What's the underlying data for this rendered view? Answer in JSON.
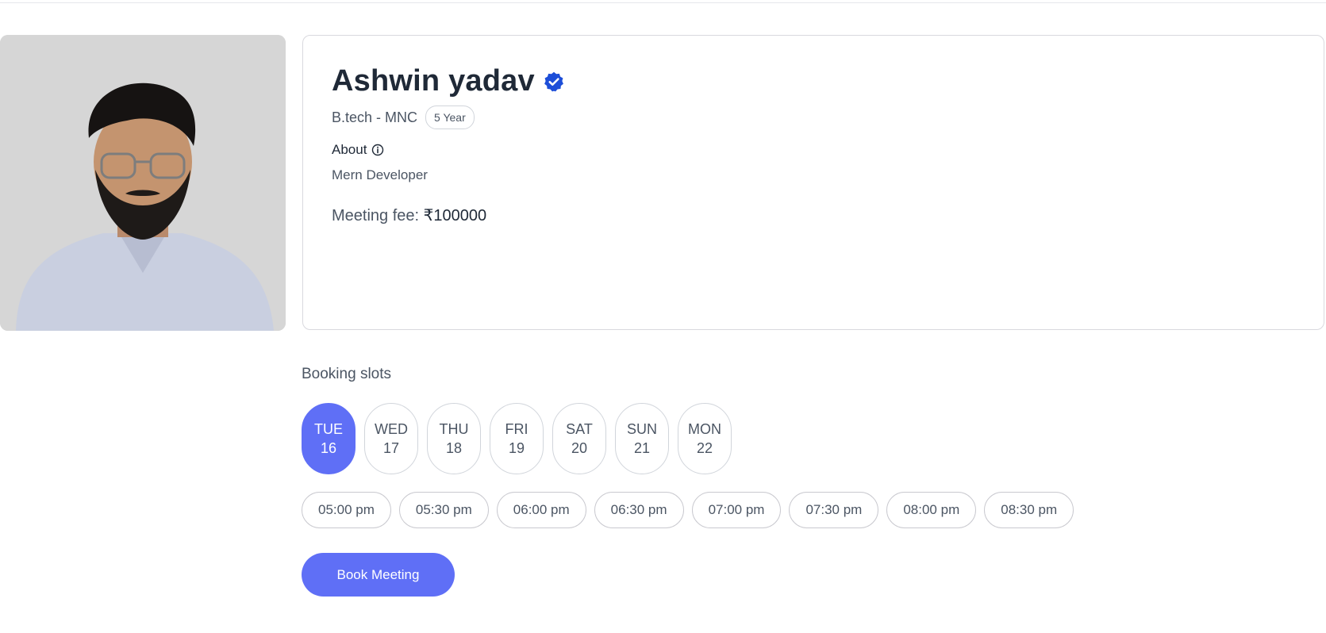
{
  "doctor": {
    "name": "Ashwin yadav",
    "degree": "B.tech - MNC",
    "experience": "5 Year",
    "about_label": "About",
    "about_text": "Mern Developer",
    "fee_label": "Meeting fee:",
    "fee_value": "₹100000",
    "photo_alt": "Ashwin yadav"
  },
  "booking": {
    "title": "Booking slots",
    "days": [
      {
        "day": "TUE",
        "date": "16",
        "selected": true
      },
      {
        "day": "WED",
        "date": "17",
        "selected": false
      },
      {
        "day": "THU",
        "date": "18",
        "selected": false
      },
      {
        "day": "FRI",
        "date": "19",
        "selected": false
      },
      {
        "day": "SAT",
        "date": "20",
        "selected": false
      },
      {
        "day": "SUN",
        "date": "21",
        "selected": false
      },
      {
        "day": "MON",
        "date": "22",
        "selected": false
      }
    ],
    "times": [
      "05:00 pm",
      "05:30 pm",
      "06:00 pm",
      "06:30 pm",
      "07:00 pm",
      "07:30 pm",
      "08:00 pm",
      "08:30 pm"
    ],
    "button_label": "Book Meeting"
  },
  "colors": {
    "accent": "#5f6ff6",
    "verified": "#1d4ed8",
    "border": "#d1d5db"
  },
  "icons": {
    "verified": "verified-badge-icon",
    "info": "info-icon"
  }
}
